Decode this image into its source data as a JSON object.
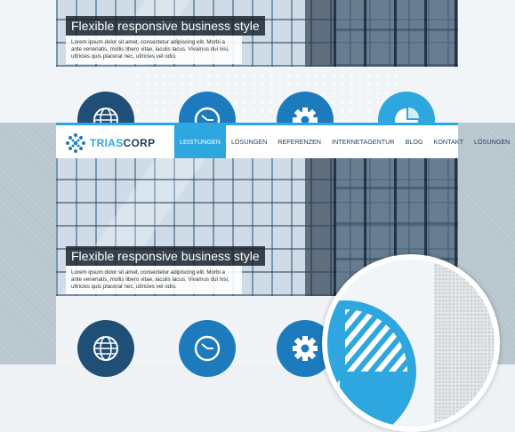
{
  "brand": {
    "part1": "TRIAS",
    "part2": "CORP"
  },
  "nav": {
    "items": [
      {
        "label": "LEISTUNGEN",
        "active": true
      },
      {
        "label": "LÖSUNGEN",
        "active": false
      },
      {
        "label": "REFERENZEN",
        "active": false
      },
      {
        "label": "INTERNETAGENTUR",
        "active": false
      },
      {
        "label": "BLOG",
        "active": false
      },
      {
        "label": "KONTAKT",
        "active": false
      },
      {
        "label": "LÖSUNGEN",
        "active": false
      }
    ]
  },
  "hero": {
    "title": "Flexible responsive business style",
    "text": "Lorem ipsum dolor sit amet, consectetur adipiscing elit. Morbi a ante venenatis, mollis libero vitae, iaculis lacus. Vivamus dui nisi, ultricies quis placerat nec, ultricies vel odio."
  },
  "features": [
    {
      "icon": "globe-icon",
      "color": "#1f4f77"
    },
    {
      "icon": "clock-icon",
      "color": "#1d7bbd"
    },
    {
      "icon": "gear-icon",
      "color": "#1d7bbd"
    },
    {
      "icon": "pie-chart-icon",
      "color": "#2ea6e0"
    }
  ],
  "colors": {
    "accent": "#2ea6e0",
    "navy": "#1f3e5a",
    "background": "#b8c6ce"
  }
}
